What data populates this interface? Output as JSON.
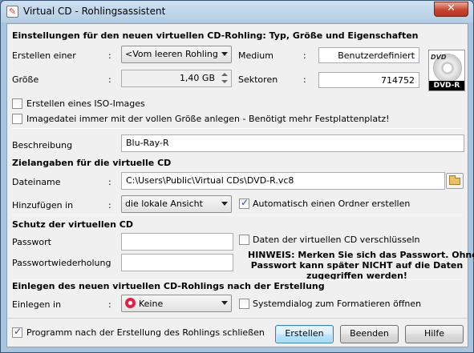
{
  "window": {
    "title": "Virtual CD - Rohlingsassistent",
    "close_label": "✕"
  },
  "section1": {
    "heading": "Einstellungen für den neuen virtuellen CD-Rohling: Typ, Größe und Eigenschaften",
    "create_label": "Erstellen einer",
    "create_value": "<Vom leeren Rohling",
    "medium_label": "Medium",
    "medium_value": "Benutzerdefiniert",
    "size_label": "Größe",
    "size_value": "1,40 GB",
    "sectors_label": "Sektoren",
    "sectors_value": "714752",
    "colon": ":",
    "iso_label": "Erstellen eines ISO-Images",
    "iso_checked": false,
    "fullsize_label": "Imagedatei immer mit der vollen Größe anlegen - Benötigt mehr Festplattenplatz!",
    "fullsize_checked": false,
    "description_label": "Beschreibung",
    "description_value": "Blu-Ray-R",
    "media_art_top": "DVD",
    "media_art_badge": "DVD-R"
  },
  "section2": {
    "heading": "Zielangaben für die virtuelle CD",
    "filename_label": "Dateiname",
    "filename_value": "C:\\Users\\Public\\Virtual CDs\\DVD-R.vc8",
    "add_label": "Hinzufügen in",
    "add_value": "die lokale Ansicht",
    "auto_folder_label": "Automatisch einen Ordner erstellen",
    "auto_folder_checked": true
  },
  "section3": {
    "heading": "Schutz der virtuellen CD",
    "password_label": "Passwort",
    "password_value": "",
    "password_repeat_label": "Passwortwiederholung",
    "password_repeat_value": "",
    "encrypt_label": "Daten der virtuellen CD verschlüsseln",
    "encrypt_checked": false,
    "hint_line1": "HINWEIS: Merken Sie sich das Passwort. Ohne",
    "hint_line2": "Passwort kann später NICHT auf die Daten",
    "hint_line3": "zugegriffen werden!"
  },
  "section4": {
    "heading": "Einlegen des neuen virtuellen CD-Rohlings nach der Erstellung",
    "insert_label": "Einlegen in",
    "insert_value": "Keine",
    "format_dialog_label": "Systemdialog zum Formatieren öffnen",
    "format_dialog_checked": false
  },
  "footer": {
    "close_after_label": "Programm nach der Erstellung des Rohlings schließen",
    "close_after_checked": true,
    "create_button": "Erstellen",
    "quit_button": "Beenden",
    "help_button": "Hilfe"
  }
}
